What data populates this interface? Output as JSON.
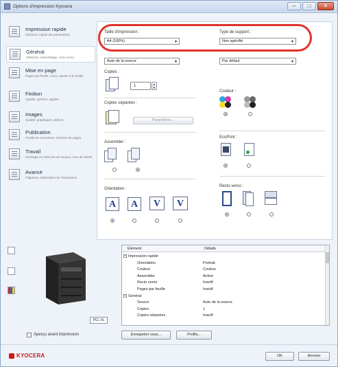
{
  "window": {
    "title": "Options d'impression Kyocera",
    "buttons": {
      "minimize": "–",
      "maximize": "□",
      "close": "✕"
    }
  },
  "sidebar": {
    "items": [
      {
        "label": "Impression rapide",
        "desc": "Sélection rapide des paramètres",
        "icon": "quick-print-icon"
      },
      {
        "label": "Général",
        "desc": "Sélection, assemblage, recto verso",
        "icon": "printer-icon"
      },
      {
        "label": "Mise en page",
        "desc": "Pages par feuille, zoom, ajuster à la feuille",
        "icon": "layout-icon"
      },
      {
        "label": "Finition",
        "desc": "Agrafer, perforer, agrafer",
        "icon": "finishing-icon"
      },
      {
        "label": "Images",
        "desc": "Qualité, graphiques, polices",
        "icon": "images-icon"
      },
      {
        "label": "Publication",
        "desc": "Feuille de couverture, insertion de pages",
        "icon": "publication-icon"
      },
      {
        "label": "Travail",
        "desc": "Stockage en mémoire de travaux, nom de travail",
        "icon": "job-icon"
      },
      {
        "label": "Avancé",
        "desc": "Filigranes, élaboration de l'impression",
        "icon": "advanced-icon"
      }
    ]
  },
  "panel": {
    "print_size_label": "Taille d'impression :",
    "print_size_value": "A4 (100%)",
    "media_type_label": "Type de support :",
    "media_type_value": "Non spécifié",
    "source_value": "Auto de la source",
    "default_value": "Par défaut",
    "copies_label": "Copies :",
    "copies_value": "1",
    "separator_copies_label": "Copies séparées :",
    "parametres_button": "Paramètres...",
    "color_label": "Couleur :",
    "ecoprint_label": "EcoPrint :",
    "assembler_label": "Assembler :",
    "duplex_label": "Recto verso :",
    "orientation_label": "Orientation :",
    "orientation_glyphs": [
      "A",
      "A",
      "V",
      "V"
    ]
  },
  "preview": {
    "pcl_tag": "PCL XL",
    "apercu_label": "Aperçu avant impression"
  },
  "summary": {
    "col_element": "Élément",
    "col_details": "Détails",
    "rows": [
      {
        "indent": 0,
        "toggle": "−",
        "key": "Impression rapide",
        "value": ""
      },
      {
        "indent": 1,
        "toggle": "",
        "key": "Orientation",
        "value": "Portrait"
      },
      {
        "indent": 1,
        "toggle": "",
        "key": "Couleur",
        "value": "Couleur"
      },
      {
        "indent": 1,
        "toggle": "",
        "key": "Assembler",
        "value": "Activé"
      },
      {
        "indent": 1,
        "toggle": "",
        "key": "Recto verso",
        "value": "Inactif"
      },
      {
        "indent": 1,
        "toggle": "",
        "key": "Pages par feuille",
        "value": "Inactif"
      },
      {
        "indent": 0,
        "toggle": "−",
        "key": "Général",
        "value": ""
      },
      {
        "indent": 1,
        "toggle": "",
        "key": "Source",
        "value": "Auto de la source"
      },
      {
        "indent": 1,
        "toggle": "",
        "key": "Copies",
        "value": "1"
      },
      {
        "indent": 1,
        "toggle": "",
        "key": "Copies séparées",
        "value": "Inactif"
      }
    ]
  },
  "bottom_buttons": {
    "save": "Enregistrer sous...",
    "profile": "Profils..."
  },
  "footer": {
    "logo": "KYOCERA",
    "ok": "OK",
    "cancel": "Annuler"
  },
  "colors": {
    "highlight": "#e0312a",
    "logo": "#cc1a1a",
    "accent": "#1a4fa8"
  }
}
